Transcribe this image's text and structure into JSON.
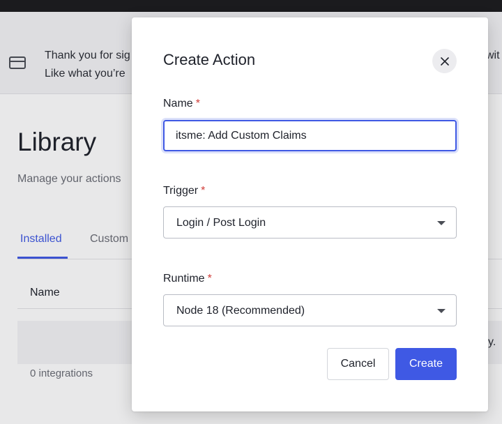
{
  "background": {
    "banner": {
      "line1": "Thank you for sig",
      "line2": "Like what you’re",
      "line1_right": "wit",
      "icon": "credit-card-icon"
    },
    "page_title": "Library",
    "page_subtitle": "Manage your actions",
    "tabs": [
      {
        "label": "Installed",
        "active": true
      },
      {
        "label": "Custom",
        "active": false
      }
    ],
    "table": {
      "column_name": "Name",
      "row_trailing": "y.",
      "integrations_count": "0 integrations"
    }
  },
  "modal": {
    "title": "Create Action",
    "close_icon": "close-icon",
    "fields": {
      "name": {
        "label": "Name",
        "required_mark": "*",
        "value": "itsme: Add Custom Claims"
      },
      "trigger": {
        "label": "Trigger",
        "required_mark": "*",
        "value": "Login / Post Login"
      },
      "runtime": {
        "label": "Runtime",
        "required_mark": "*",
        "value": "Node 18 (Recommended)"
      }
    },
    "buttons": {
      "cancel": "Cancel",
      "create": "Create"
    }
  },
  "colors": {
    "accent": "#3f59e4",
    "required": "#d03c38"
  }
}
